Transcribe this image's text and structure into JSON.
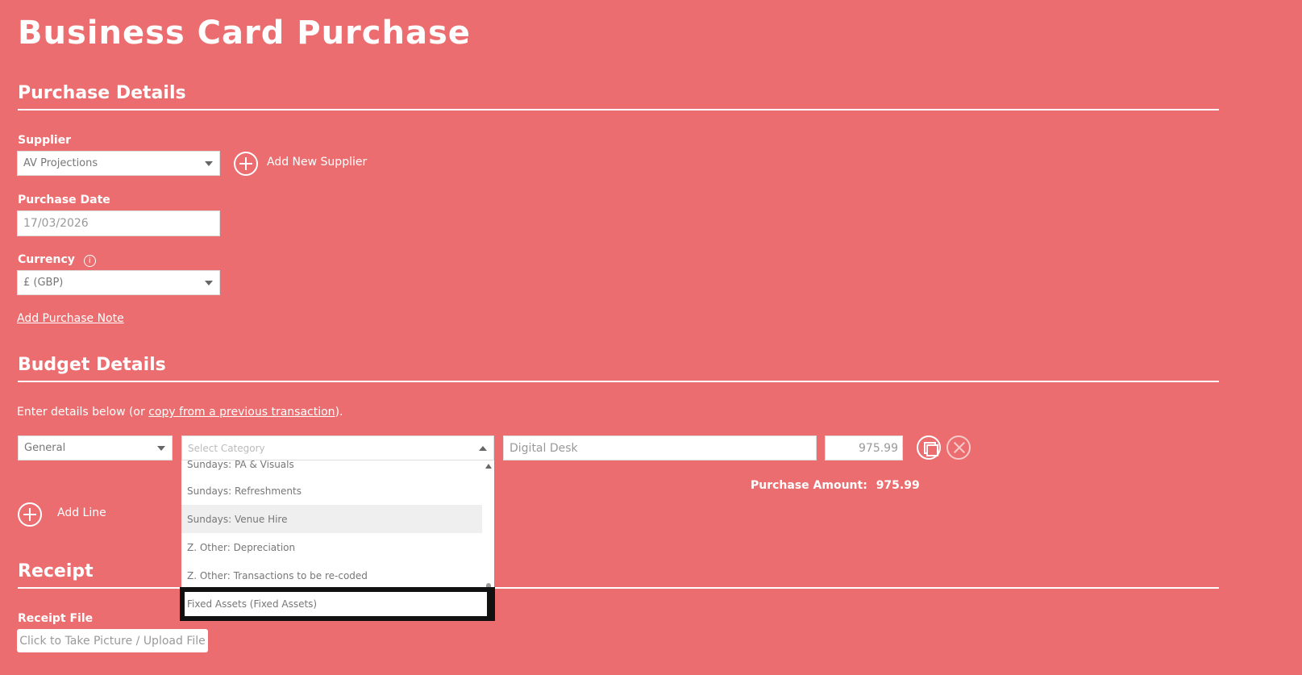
{
  "page": {
    "title": "Business Card Purchase"
  },
  "purchase_details": {
    "heading": "Purchase Details",
    "supplier_label": "Supplier",
    "supplier_value": "AV Projections",
    "add_supplier_label": "Add New Supplier",
    "date_label": "Purchase Date",
    "date_value": "17/03/2026",
    "currency_label": "Currency",
    "currency_value": "£ (GBP)",
    "add_note_label": "Add Purchase Note"
  },
  "budget_details": {
    "heading": "Budget Details",
    "intro_prefix": "Enter details below (or ",
    "intro_link": "copy from a previous transaction",
    "intro_suffix": ").",
    "fund_value": "General",
    "category_placeholder": "Select Category",
    "description_value": "Digital Desk",
    "amount_value": "975.99",
    "purchase_amount_label": "Purchase Amount:",
    "purchase_amount_value": "975.99",
    "add_line_label": "Add Line",
    "category_options": [
      "Sundays: PA & Visuals",
      "Sundays: Refreshments",
      "Sundays: Venue Hire",
      "Z. Other: Depreciation",
      "Z. Other: Transactions to be re-coded",
      "Fixed Assets (Fixed Assets)"
    ]
  },
  "receipt": {
    "heading": "Receipt",
    "file_label": "Receipt File",
    "upload_button": "Click to Take Picture / Upload File"
  },
  "icons": [
    "plus-circle-icon",
    "info-icon",
    "chevron-down-icon",
    "duplicate-line-icon",
    "close-icon"
  ]
}
